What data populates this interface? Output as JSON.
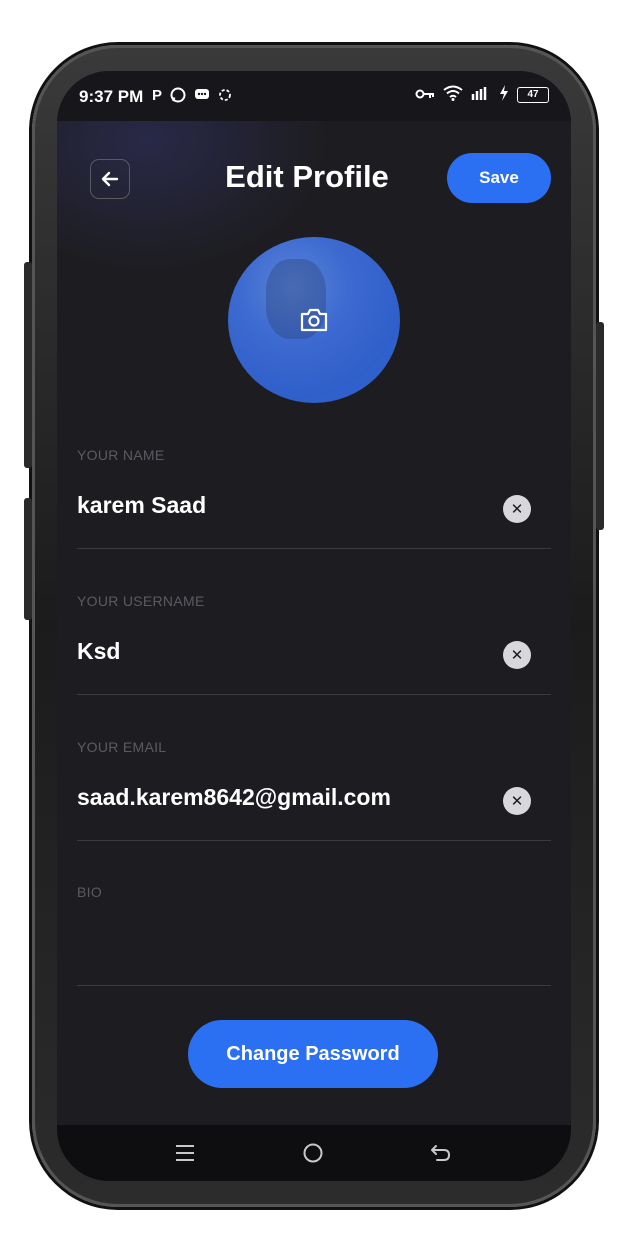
{
  "status_bar": {
    "time": "9:37 PM",
    "left_icons": [
      "P",
      "whatsapp-icon",
      "chat-icon",
      "app-icon"
    ],
    "right_icons": [
      "key-icon",
      "wifi-icon",
      "signal-icon",
      "charging-icon"
    ],
    "battery": "47"
  },
  "header": {
    "back_icon": "arrow-left-icon",
    "title": "Edit Profile",
    "save_label": "Save"
  },
  "avatar": {
    "overlay_icon": "camera-icon"
  },
  "fields": [
    {
      "label": "YOUR NAME",
      "value": "karem Saad"
    },
    {
      "label": "YOUR USERNAME",
      "value": "Ksd"
    },
    {
      "label": "YOUR EMAIL",
      "value": "saad.karem8642@gmail.com"
    },
    {
      "label": "BIO",
      "value": ""
    }
  ],
  "change_password_label": "Change Password",
  "nav": {
    "recents_icon": "menu-icon",
    "home_icon": "home-circle-icon",
    "back_icon": "back-arrow-icon"
  },
  "colors": {
    "accent": "#2b6ff2",
    "background": "#1d1d21",
    "label": "#5a5a60",
    "text": "#ffffff"
  }
}
